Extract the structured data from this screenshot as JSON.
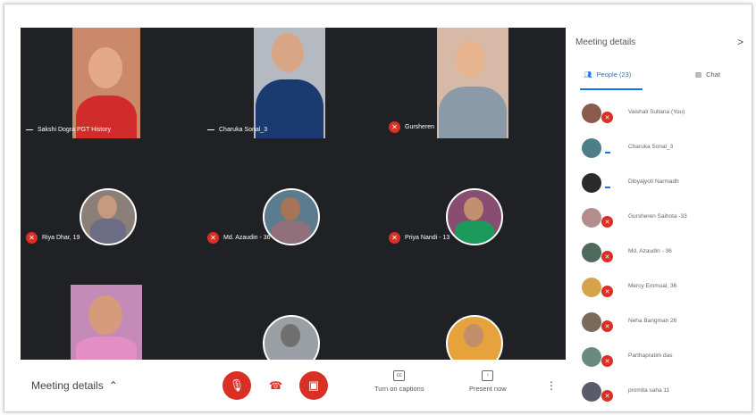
{
  "tiles": [
    {
      "name": "Sakshi Dogra PGT History",
      "type": "video",
      "indicator": "dash"
    },
    {
      "name": "Charuka Sonal_3",
      "type": "video",
      "indicator": "dash"
    },
    {
      "name": "Gursheren",
      "type": "video",
      "indicator": "muted"
    },
    {
      "name": "Riya Dhar, 19",
      "type": "avatar",
      "indicator": "muted"
    },
    {
      "name": "Md. Azaudin - 36",
      "type": "avatar",
      "indicator": "muted"
    },
    {
      "name": "Priya Nandi - 13",
      "type": "avatar",
      "indicator": "muted"
    },
    {
      "name": "",
      "type": "video",
      "indicator": "none"
    },
    {
      "name": "",
      "type": "avatar",
      "indicator": "none"
    },
    {
      "name": "",
      "type": "avatar",
      "indicator": "none"
    }
  ],
  "bottom_bar": {
    "meeting_details": "Meeting details",
    "chevron": "^",
    "mic_icon": "mic-off-icon",
    "hangup_icon": "hangup-icon",
    "camera_icon": "camera-off-icon",
    "captions_label": "Turn on captions",
    "present_label": "Present now",
    "more": "⋮"
  },
  "sidebar": {
    "title": "Meeting details",
    "close": ">",
    "people_tab": "People (23)",
    "chat_tab": "Chat",
    "people": [
      {
        "name": "Vaishali Sultana (You)",
        "status": "muted"
      },
      {
        "name": "Charuka Sonal_3",
        "status": "camera"
      },
      {
        "name": "Dibyajyoti Narmadh",
        "status": "camera"
      },
      {
        "name": "Gursheren Saihota -33",
        "status": "muted"
      },
      {
        "name": "Md. Azaudin - 36",
        "status": "muted"
      },
      {
        "name": "Mercy Emmual, 36",
        "status": "muted"
      },
      {
        "name": "Neha Bangman 26",
        "status": "muted"
      },
      {
        "name": "Parthapratim das",
        "status": "muted"
      },
      {
        "name": "promita saha 11",
        "status": "muted"
      }
    ]
  },
  "colors": {
    "grid_bg": "#202124",
    "muted_red": "#d93025",
    "accent_blue": "#1a73e8"
  }
}
